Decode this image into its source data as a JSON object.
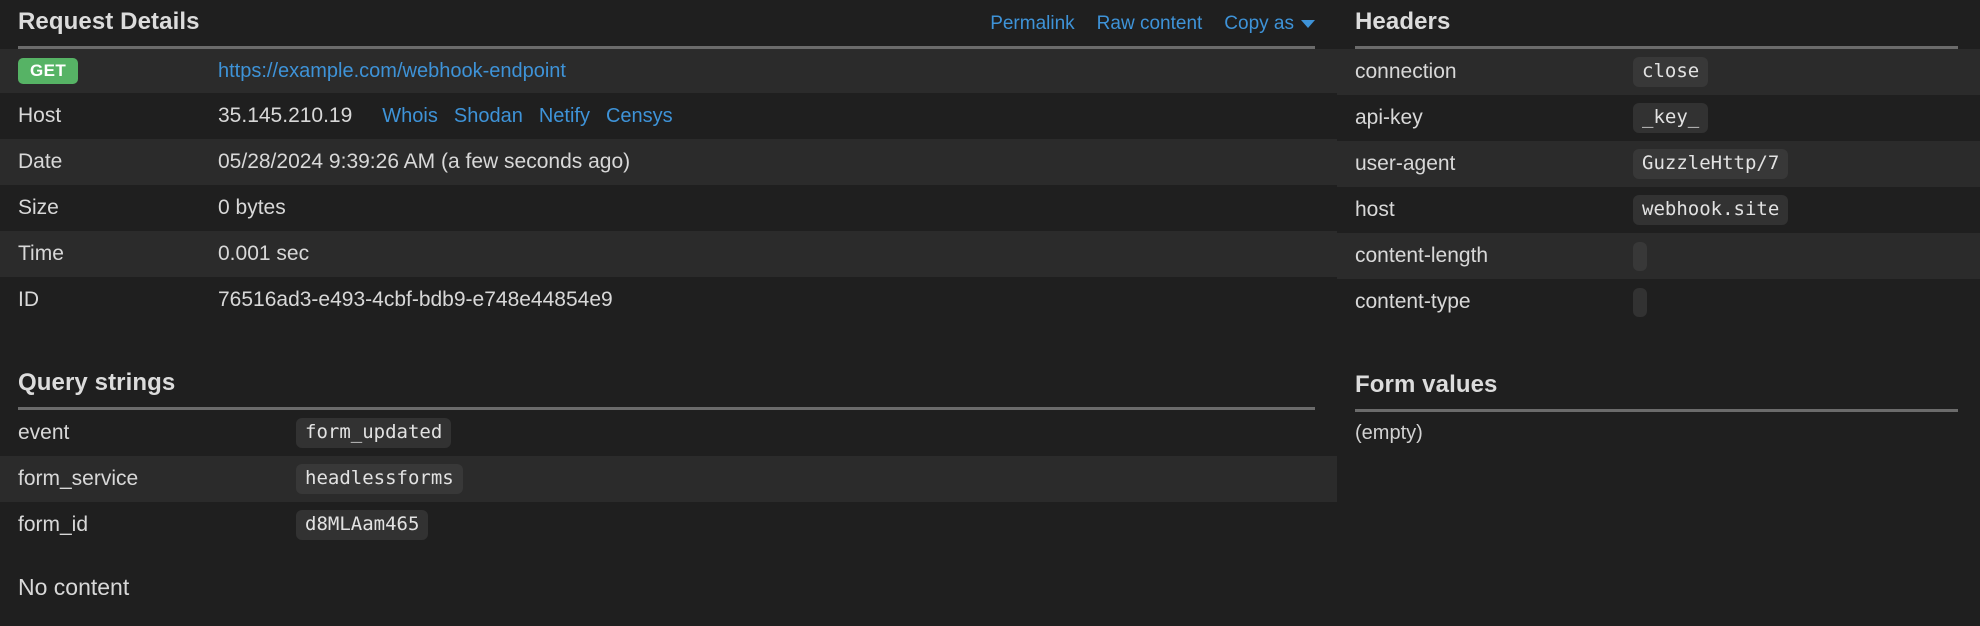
{
  "request_details": {
    "title": "Request Details",
    "actions": [
      {
        "label": "Permalink",
        "name": "permalink-link"
      },
      {
        "label": "Raw content",
        "name": "raw-content-link"
      },
      {
        "label": "Copy as",
        "name": "copy-as-dropdown"
      }
    ],
    "method": "GET",
    "url": "https://example.com/webhook-endpoint",
    "rows": [
      {
        "label": "Host",
        "value": "35.145.210.19"
      },
      {
        "label": "Date",
        "value": "05/28/2024 9:39:26 AM (a few seconds ago)"
      },
      {
        "label": "Size",
        "value": "0 bytes"
      },
      {
        "label": "Time",
        "value": "0.001 sec"
      },
      {
        "label": "ID",
        "value": "76516ad3-e493-4cbf-bdb9-e748e44854e9"
      }
    ],
    "host_links": [
      {
        "label": "Whois"
      },
      {
        "label": "Shodan"
      },
      {
        "label": "Netify"
      },
      {
        "label": "Censys"
      }
    ]
  },
  "query_strings": {
    "title": "Query strings",
    "rows": [
      {
        "key": "event",
        "value": "form_updated"
      },
      {
        "key": "form_service",
        "value": "headlessforms"
      },
      {
        "key": "form_id",
        "value": "d8MLAam465"
      }
    ]
  },
  "content": {
    "no_content_text": "No content"
  },
  "headers": {
    "title": "Headers",
    "rows": [
      {
        "key": "connection",
        "value": "close"
      },
      {
        "key": "api-key",
        "value": "_key_"
      },
      {
        "key": "user-agent",
        "value": "GuzzleHttp/7"
      },
      {
        "key": "host",
        "value": "webhook.site"
      },
      {
        "key": "content-length",
        "value": ""
      },
      {
        "key": "content-type",
        "value": ""
      }
    ]
  },
  "form_values": {
    "title": "Form values",
    "empty_text": "(empty)"
  },
  "colors": {
    "background": "#1f1f1f",
    "row_alt": "#2b2b2b",
    "link": "#3e93d8",
    "method_get": "#56b365",
    "chip_bg": "#323232",
    "rule": "#6b6b6b",
    "text": "#d8d8d8"
  }
}
